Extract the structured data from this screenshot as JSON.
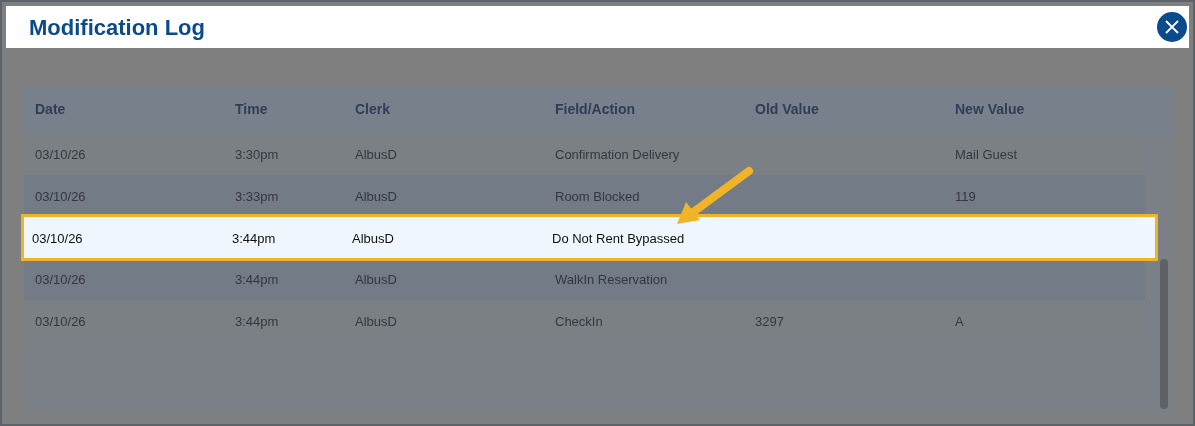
{
  "dialog": {
    "title": "Modification Log"
  },
  "table": {
    "columns": [
      "Date",
      "Time",
      "Clerk",
      "Field/Action",
      "Old Value",
      "New Value"
    ],
    "rows": [
      {
        "cells": [
          "03/10/26",
          "3:30pm",
          "AlbusD",
          "Confirmation Delivery",
          "",
          "Mail Guest"
        ],
        "highlighted": false
      },
      {
        "cells": [
          "03/10/26",
          "3:33pm",
          "AlbusD",
          "Room Blocked",
          "",
          "119"
        ],
        "highlighted": false
      },
      {
        "cells": [
          "03/10/26",
          "3:44pm",
          "AlbusD",
          "Do Not Rent Bypassed",
          "",
          ""
        ],
        "highlighted": true
      },
      {
        "cells": [
          "03/10/26",
          "3:44pm",
          "AlbusD",
          "WalkIn Reservation",
          "",
          ""
        ],
        "highlighted": false
      },
      {
        "cells": [
          "03/10/26",
          "3:44pm",
          "AlbusD",
          "CheckIn",
          "3297",
          "A"
        ],
        "highlighted": false
      }
    ]
  }
}
